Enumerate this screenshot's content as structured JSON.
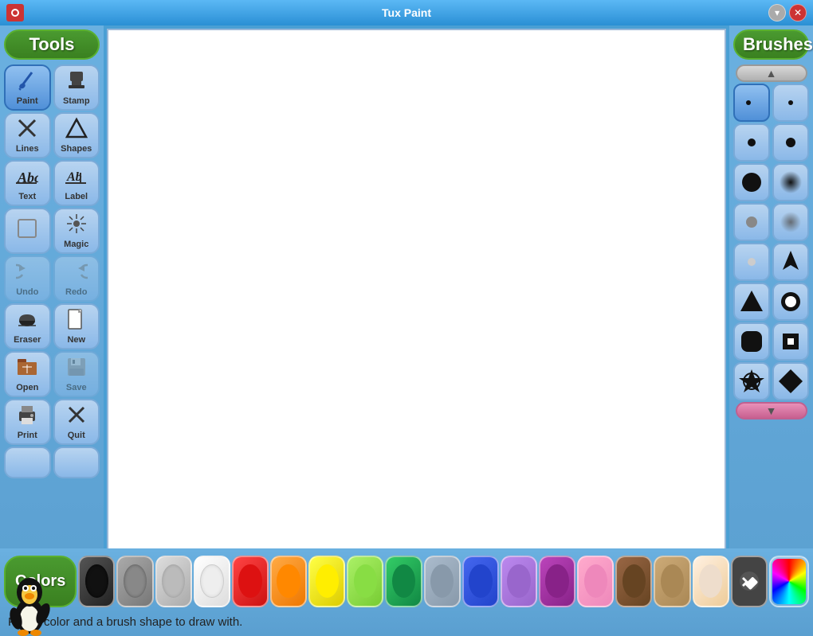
{
  "titlebar": {
    "title": "Tux Paint",
    "minimize_label": "▾",
    "close_label": "✕"
  },
  "tools": {
    "header": "Tools",
    "buttons": [
      {
        "id": "paint",
        "label": "Paint",
        "icon": "🖌",
        "active": true
      },
      {
        "id": "stamp",
        "label": "Stamp",
        "icon": "📮",
        "active": false
      },
      {
        "id": "lines",
        "label": "Lines",
        "icon": "✕",
        "active": false
      },
      {
        "id": "shapes",
        "label": "Shapes",
        "icon": "⬟",
        "active": false
      },
      {
        "id": "text",
        "label": "Text",
        "icon": "Abc",
        "active": false
      },
      {
        "id": "label",
        "label": "Label",
        "icon": "Ab",
        "active": false
      },
      {
        "id": "fill",
        "label": "",
        "icon": "⬜",
        "active": false
      },
      {
        "id": "magic",
        "label": "Magic",
        "icon": "✦",
        "active": false
      },
      {
        "id": "undo",
        "label": "Undo",
        "icon": "↺",
        "active": false,
        "disabled": true
      },
      {
        "id": "redo",
        "label": "Redo",
        "icon": "↻",
        "active": false,
        "disabled": true
      },
      {
        "id": "eraser",
        "label": "Eraser",
        "icon": "🧹",
        "active": false
      },
      {
        "id": "new",
        "label": "New",
        "icon": "📄",
        "active": false
      },
      {
        "id": "open",
        "label": "Open",
        "icon": "📖",
        "active": false
      },
      {
        "id": "save",
        "label": "Save",
        "icon": "💾",
        "active": false,
        "disabled": true
      },
      {
        "id": "print",
        "label": "Print",
        "icon": "🖨",
        "active": false
      },
      {
        "id": "quit",
        "label": "Quit",
        "icon": "✕",
        "active": false
      }
    ]
  },
  "brushes": {
    "header": "Brushes",
    "scroll_up": "▲",
    "scroll_down": "▼"
  },
  "colors": {
    "header": "Colors",
    "swatches": [
      {
        "name": "black",
        "color": "#111111"
      },
      {
        "name": "dark-gray",
        "color": "#888888"
      },
      {
        "name": "light-gray",
        "color": "#bbbbbb"
      },
      {
        "name": "white",
        "color": "#eeeeee"
      },
      {
        "name": "red",
        "color": "#dd1111"
      },
      {
        "name": "orange",
        "color": "#ff8800"
      },
      {
        "name": "yellow",
        "color": "#ffee00"
      },
      {
        "name": "light-green",
        "color": "#88dd44"
      },
      {
        "name": "green",
        "color": "#118844"
      },
      {
        "name": "gray-blue",
        "color": "#8899aa"
      },
      {
        "name": "blue",
        "color": "#2244cc"
      },
      {
        "name": "light-purple",
        "color": "#9966cc"
      },
      {
        "name": "purple",
        "color": "#882288"
      },
      {
        "name": "pink",
        "color": "#ee88bb"
      },
      {
        "name": "brown",
        "color": "#664422"
      },
      {
        "name": "tan",
        "color": "#aa8855"
      },
      {
        "name": "peach",
        "color": "#eeddcc"
      }
    ]
  },
  "status": {
    "message": "Pick a color and a brush shape to draw with."
  }
}
